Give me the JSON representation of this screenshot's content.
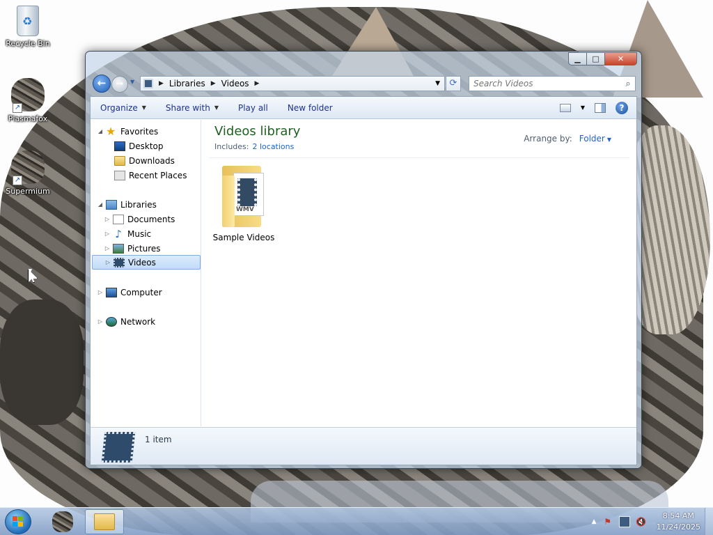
{
  "desktop": {
    "icons": [
      {
        "label": "Recycle Bin",
        "icon": "recycle-bin-icon"
      },
      {
        "label": "Plasmafox",
        "icon": "cat-app-icon"
      },
      {
        "label": "Supermium",
        "icon": "cat-app-icon"
      }
    ]
  },
  "explorer": {
    "address": {
      "segments": [
        "Libraries",
        "Videos"
      ]
    },
    "search": {
      "placeholder": "Search Videos"
    },
    "toolbar": {
      "organize_label": "Organize",
      "share_label": "Share with",
      "play_all_label": "Play all",
      "new_folder_label": "New folder"
    },
    "nav_pane": {
      "favorites_label": "Favorites",
      "favorites_items": [
        "Desktop",
        "Downloads",
        "Recent Places"
      ],
      "libraries_label": "Libraries",
      "library_items": [
        "Documents",
        "Music",
        "Pictures",
        "Videos"
      ],
      "selected_item": "Videos",
      "computer_label": "Computer",
      "network_label": "Network"
    },
    "main": {
      "library_title": "Videos library",
      "includes_label": "Includes:",
      "includes_link": "2 locations",
      "arrange_label": "Arrange by:",
      "arrange_value": "Folder",
      "items": [
        {
          "name": "Sample Videos",
          "badge": "WMV",
          "icon": "video-folder-icon"
        }
      ]
    },
    "details": {
      "count_text": "1 item"
    }
  },
  "taskbar": {
    "clock_time": "8:54 AM",
    "clock_date": "11/24/2025"
  },
  "colors": {
    "library_title": "#1e5f20",
    "link": "#1e64c8",
    "selection": "#c1dcf8",
    "close_button": "#c8432b"
  }
}
